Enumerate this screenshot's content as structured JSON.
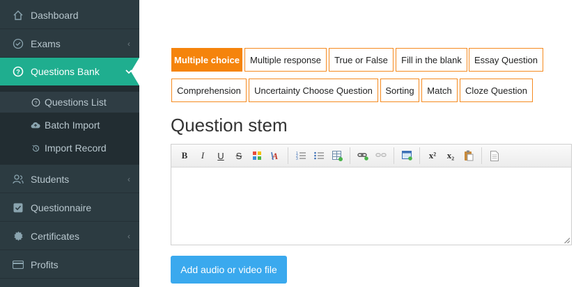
{
  "sidebar": {
    "items": [
      {
        "label": "Dashboard",
        "icon": "home-icon"
      },
      {
        "label": "Exams",
        "icon": "check-circle-icon"
      },
      {
        "label": "Questions Bank",
        "icon": "question-circle-icon"
      },
      {
        "label": "Students",
        "icon": "users-icon"
      },
      {
        "label": "Questionnaire",
        "icon": "checkbox-icon"
      },
      {
        "label": "Certificates",
        "icon": "certificate-icon"
      },
      {
        "label": "Profits",
        "icon": "credit-card-icon"
      }
    ],
    "submenu": [
      {
        "label": "Questions List",
        "icon": "question-circle-icon"
      },
      {
        "label": "Batch Import",
        "icon": "cloud-upload-icon"
      },
      {
        "label": "Import Record",
        "icon": "history-icon"
      }
    ]
  },
  "question_types": [
    "Multiple choice",
    "Multiple response",
    "True or False",
    "Fill in the blank",
    "Essay Question",
    "Comprehension",
    "Uncertainty Choose Question",
    "Sorting",
    "Match",
    "Cloze Question"
  ],
  "selected_type": "Multiple choice",
  "stem_title": "Question stem",
  "toolbar": {
    "bold": "B",
    "italic": "I",
    "underline": "U",
    "strike": "S",
    "superscript": "x²",
    "subscript": "x₂"
  },
  "upload_button": "Add audio or video file",
  "colors": {
    "sidebar": "#2c3b41",
    "active": "#1fae8f",
    "orange": "#f5840c",
    "upload": "#3aa9ee"
  }
}
